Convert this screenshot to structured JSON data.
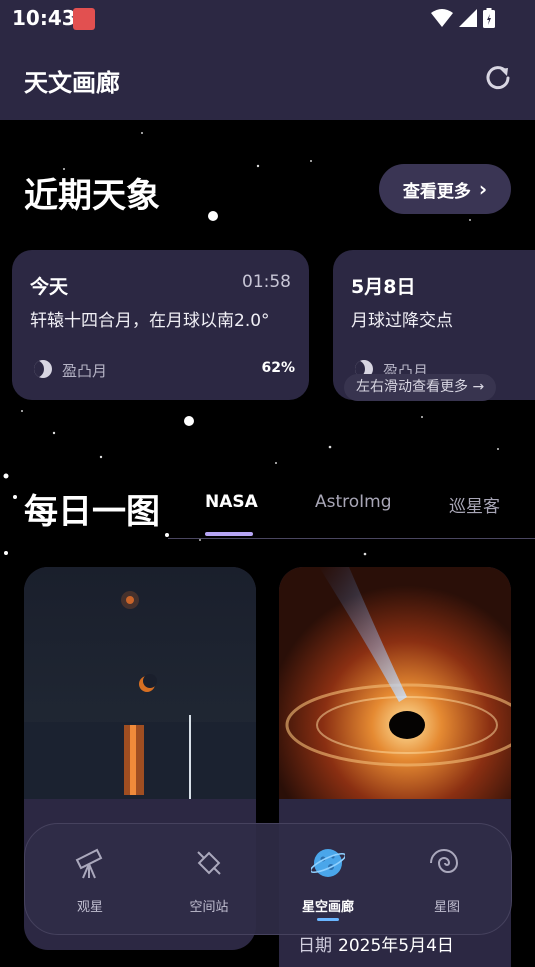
{
  "status_bar": {
    "time": "10:43"
  },
  "app_bar": {
    "title": "天文画廊"
  },
  "upcoming": {
    "title": "近期天象",
    "more_label": "查看更多",
    "cards": [
      {
        "date": "今天",
        "time": "01:58",
        "desc": "轩辕十四合月，在月球以南2.0°",
        "phase": "盈凸月",
        "pct": "62%"
      },
      {
        "date": "5月8日",
        "desc": "月球过降交点",
        "phase": "盈凸月"
      }
    ],
    "hint": "左右滑动查看更多 →"
  },
  "daily": {
    "title": "每日一图",
    "tabs": [
      "NASA",
      "AstroImg",
      "巡星客"
    ],
    "active_tab": 0,
    "photo_date_label": "日期",
    "photo_date": "2025年5月4日"
  },
  "nav": {
    "items": [
      {
        "label": "观星",
        "icon": "telescope-icon"
      },
      {
        "label": "空间站",
        "icon": "satellite-icon"
      },
      {
        "label": "星空画廊",
        "icon": "planet-icon"
      },
      {
        "label": "星图",
        "icon": "galaxy-icon"
      }
    ],
    "active": 2
  },
  "colors": {
    "bar_bg": "#2c2843",
    "accent": "#b7a6f5",
    "nav_active": "#6ab6ff"
  }
}
